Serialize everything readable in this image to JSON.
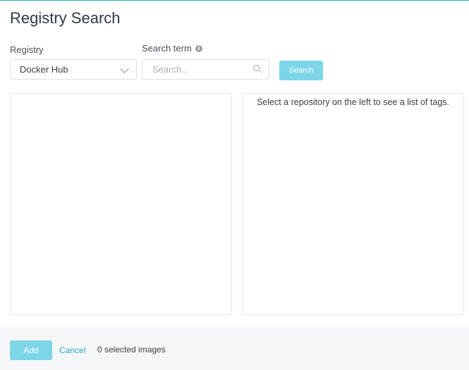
{
  "page": {
    "title": "Registry Search"
  },
  "form": {
    "registry_label": "Registry",
    "registry_value": "Docker Hub",
    "search_label": "Search term",
    "search_placeholder": "Search...",
    "search_value": "",
    "search_button": "Search"
  },
  "panels": {
    "repositories_message": "",
    "tags_message": "Select a repository on the left to see a list of tags."
  },
  "footer": {
    "add_label": "Add",
    "cancel_label": "Cancel",
    "selected_count_text": "0 selected images"
  },
  "colors": {
    "accent": "#7dd6e8",
    "link": "#2aa8c6",
    "top_border": "#22b5a8"
  },
  "icons": {
    "info": "info-icon",
    "search": "search-icon",
    "dropdown": "chevron-down-icon"
  }
}
